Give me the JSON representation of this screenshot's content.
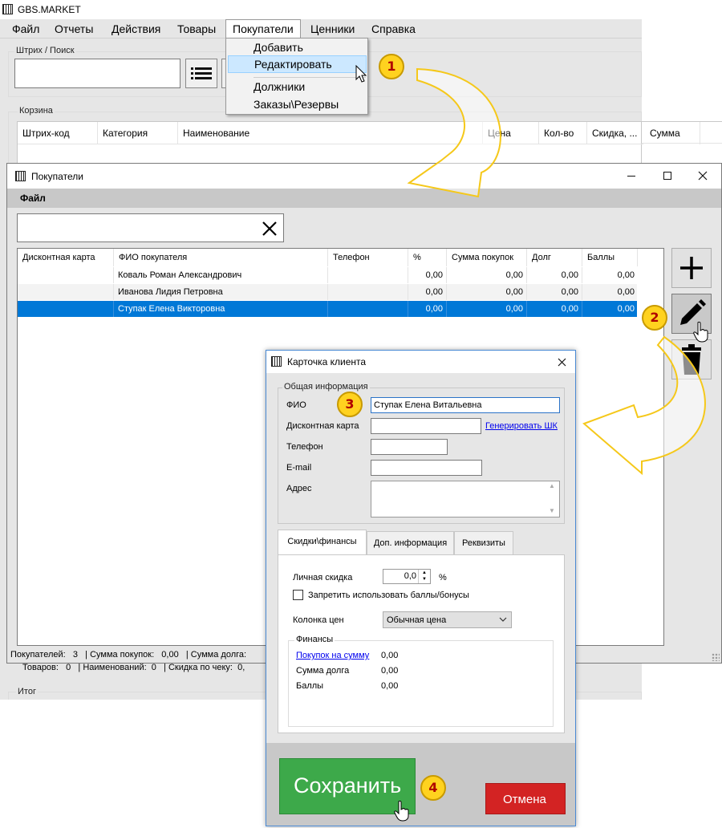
{
  "main_window": {
    "title": "GBS.MARKET",
    "menu": [
      "Файл",
      "Отчеты",
      "Действия",
      "Товары",
      "Покупатели",
      "Ценники",
      "Справка"
    ],
    "search_group_label": "Штрих / Поиск",
    "cart_group_label": "Корзина",
    "cart_columns": [
      "Штрих-код",
      "Категория",
      "Наименование",
      "Цена",
      "Кол-во",
      "Скидка, ...",
      "Сумма"
    ],
    "status_line": "Товаров:   0   | Наименований:  0   | Скидка по чеку:  0,",
    "total_group_label": "Итог"
  },
  "buyers_menu": {
    "items": [
      "Добавить",
      "Редактировать",
      "Должники",
      "Заказы\\Резервы"
    ],
    "highlighted": "Редактировать"
  },
  "customers_window": {
    "title": "Покупатели",
    "menu_label": "Файл",
    "search_value": "",
    "clear_icon": "close-x-icon",
    "columns": [
      "Дисконтная карта",
      "ФИО покупателя",
      "Телефон",
      "%",
      "Сумма покупок",
      "Долг",
      "Баллы"
    ],
    "rows": [
      {
        "card": "",
        "name": "Коваль Роман Александрович",
        "phone": "",
        "pct": "0,00",
        "sum": "0,00",
        "debt": "0,00",
        "points": "0,00"
      },
      {
        "card": "",
        "name": "Иванова Лидия Петровна",
        "phone": "",
        "pct": "0,00",
        "sum": "0,00",
        "debt": "0,00",
        "points": "0,00"
      },
      {
        "card": "",
        "name": "Ступак Елена Викторовна",
        "phone": "",
        "pct": "0,00",
        "sum": "0,00",
        "debt": "0,00",
        "points": "0,00"
      }
    ],
    "selected_row": 2,
    "status": "Покупателей:   3   | Сумма покупок:   0,00   | Сумма долга:",
    "buttons": {
      "add": "plus-icon",
      "edit": "pencil-icon",
      "delete": "trash-icon"
    }
  },
  "client_card": {
    "title": "Карточка клиента",
    "general_label": "Общая информация",
    "fio_label": "ФИО",
    "fio_value": "Ступак Елена Витальевна",
    "card_label": "Дисконтная карта",
    "card_value": "",
    "generate_link": "Генерировать ШК",
    "phone_label": "Телефон",
    "phone_value": "",
    "email_label": "E-mail",
    "email_value": "",
    "address_label": "Адрес",
    "address_value": "",
    "tabs": [
      "Скидки\\финансы",
      "Доп. информация",
      "Реквизиты"
    ],
    "active_tab": "Скидки\\финансы",
    "discount_label": "Личная скидка",
    "discount_value": "0,0",
    "discount_unit": "%",
    "forbid_points_label": "Запретить использовать баллы/бонусы",
    "forbid_points_checked": false,
    "price_column_label": "Колонка цен",
    "price_column_value": "Обычная цена",
    "finance_label": "Финансы",
    "purchases_link": "Покупок на сумму",
    "purchases_value": "0,00",
    "debt_label": "Сумма долга",
    "debt_value": "0,00",
    "points_label": "Баллы",
    "points_value": "0,00",
    "save_label": "Сохранить",
    "cancel_label": "Отмена"
  },
  "callouts": [
    "1",
    "2",
    "3",
    "4"
  ],
  "colors": {
    "selection": "#0078d7",
    "menu_highlight": "#cce8ff",
    "save_button": "#3da94a",
    "cancel_button": "#d32323",
    "badge": "#ffd21f",
    "arrow": "#f5c81a",
    "link": "#0000ee"
  }
}
